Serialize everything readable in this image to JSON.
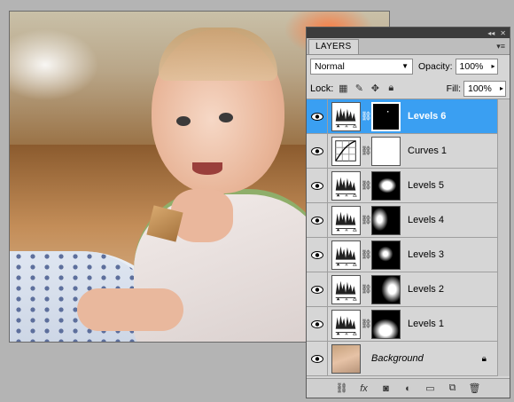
{
  "panel": {
    "tab_label": "LAYERS",
    "blend_mode": "Normal",
    "opacity_label": "Opacity:",
    "opacity_value": "100%",
    "lock_label": "Lock:",
    "fill_label": "Fill:",
    "fill_value": "100%"
  },
  "layers": [
    {
      "name": "Levels 6",
      "type": "levels",
      "selected": true,
      "mask": "black-dot"
    },
    {
      "name": "Curves 1",
      "type": "curves",
      "selected": false,
      "mask": "white"
    },
    {
      "name": "Levels 5",
      "type": "levels",
      "selected": false,
      "mask": "blob-right"
    },
    {
      "name": "Levels 4",
      "type": "levels",
      "selected": false,
      "mask": "blob-left"
    },
    {
      "name": "Levels 3",
      "type": "levels",
      "selected": false,
      "mask": "blob-center"
    },
    {
      "name": "Levels 2",
      "type": "levels",
      "selected": false,
      "mask": "blob-right-large"
    },
    {
      "name": "Levels 1",
      "type": "levels",
      "selected": false,
      "mask": "blob-bottom"
    },
    {
      "name": "Background",
      "type": "background",
      "selected": false,
      "locked": true
    }
  ],
  "bottom_icons": [
    "link-icon",
    "fx-icon",
    "mask-icon",
    "adjustment-icon",
    "group-icon",
    "new-layer-icon",
    "trash-icon"
  ],
  "colors": {
    "selection": "#3a9ff2",
    "panel_bg": "#d6d6d6",
    "workspace": "#b4b4b4"
  }
}
